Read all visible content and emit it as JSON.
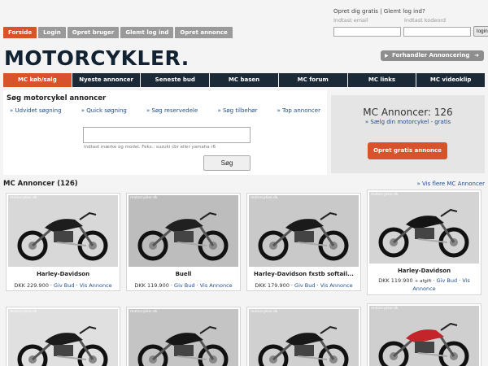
{
  "header": {
    "tabs": [
      {
        "label": "Forside",
        "active": true
      },
      {
        "label": "Login",
        "active": false
      },
      {
        "label": "Opret bruger",
        "active": false
      },
      {
        "label": "Glemt log ind",
        "active": false
      },
      {
        "label": "Opret annonce",
        "active": false
      }
    ],
    "login": {
      "create_free": "Opret dig gratis",
      "separator": " | ",
      "forgot": "Glemt log ind?",
      "email_label": "Indtast email",
      "password_label": "Indtast kodeord",
      "button": "login"
    },
    "logo": "MOTORCYKLER.",
    "dealer_button": "Forhandler Annoncering"
  },
  "nav": [
    {
      "label": "MC køb/salg",
      "active": true
    },
    {
      "label": "Nyeste annoncer",
      "active": false
    },
    {
      "label": "Seneste bud",
      "active": false
    },
    {
      "label": "MC basen",
      "active": false
    },
    {
      "label": "MC forum",
      "active": false
    },
    {
      "label": "MC links",
      "active": false
    },
    {
      "label": "MC videoklip",
      "active": false
    }
  ],
  "search": {
    "title": "Søg motorcykel annoncer",
    "links": [
      "» Udvidet søgning",
      "» Quick søgning",
      "» Søg reservedele",
      "» Søg tilbehør",
      "» Top annoncer"
    ],
    "input_value": "",
    "hint": "Indtast mærke og model. Feks.: suzuki cbr eller yamaha r6",
    "button": "Søg"
  },
  "ad_panel": {
    "count_text": "MC Annoncer: 126",
    "sell_link": "» Sælg din motorcykel - gratis",
    "create_button": "Opret gratis annonce"
  },
  "listings": {
    "heading": "MC Annoncer (126)",
    "more_link": "» Vis flere MC Annoncer",
    "watermark": "motorcykler.dk",
    "bid_label": "Giv Bud",
    "view_label": "Vis Annonce",
    "items": [
      {
        "title": "Harley-Davidson",
        "price": "DKK 229.900",
        "extra": ""
      },
      {
        "title": "Buell",
        "price": "DKK 119.900",
        "extra": ""
      },
      {
        "title": "Harley-Davidson fxstb softail...",
        "price": "DKK 179.900",
        "extra": ""
      },
      {
        "title": "Harley-Davidson",
        "price": "DKK 119.900",
        "extra": "+ afgift"
      },
      {
        "title": "",
        "price": "",
        "extra": ""
      },
      {
        "title": "",
        "price": "",
        "extra": ""
      },
      {
        "title": "",
        "price": "",
        "extra": ""
      },
      {
        "title": "",
        "price": "",
        "extra": ""
      }
    ]
  },
  "colors": {
    "accent": "#d8532c",
    "nav_bg": "#1c2a38",
    "link": "#1f4d8a"
  }
}
